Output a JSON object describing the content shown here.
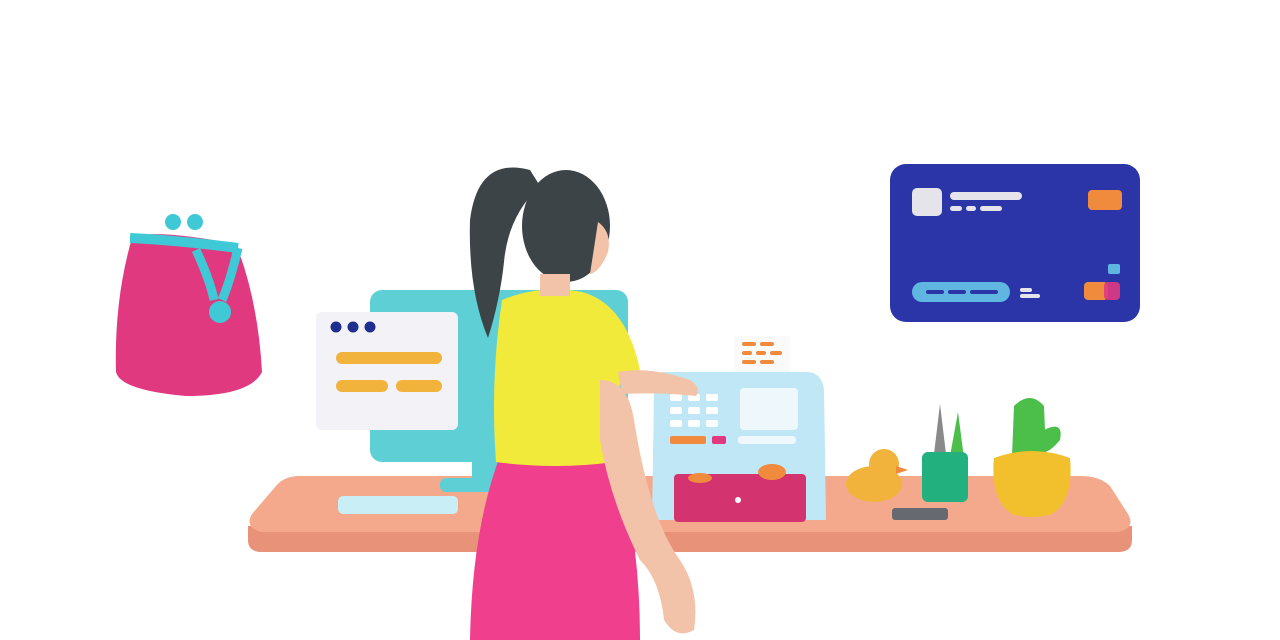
{
  "scene": {
    "background": "#ffffff",
    "colors": {
      "desk": "#f4a98c",
      "desk_edge": "#e8927a",
      "purse": "#e0397f",
      "purse_clasp": "#3fc9d6",
      "monitor": "#5fcfd6",
      "window_panel": "#f2f2f7",
      "window_dots": "#1f2f8f",
      "window_bars": "#f2b33d",
      "register": "#bfe7f6",
      "register_drawer": "#d3336f",
      "receipt_marks": "#f08a3c",
      "card": "#2b35a8",
      "card_chip": "#f08a3c",
      "shirt": "#f2ea3a",
      "pants": "#f03f8d",
      "hair": "#3d4447",
      "skin": "#f2c3a8",
      "duck": "#f2b33d",
      "pencil_cup": "#22b07f",
      "plant_pot": "#f2c02c",
      "cactus": "#4bbf4a"
    },
    "objects": [
      "coin-purse",
      "monitor",
      "browser-window",
      "woman",
      "cash-register",
      "receipt",
      "credit-card",
      "rubber-duck",
      "pencil-cup",
      "cactus-plant",
      "desk",
      "keyboard",
      "phone"
    ]
  }
}
